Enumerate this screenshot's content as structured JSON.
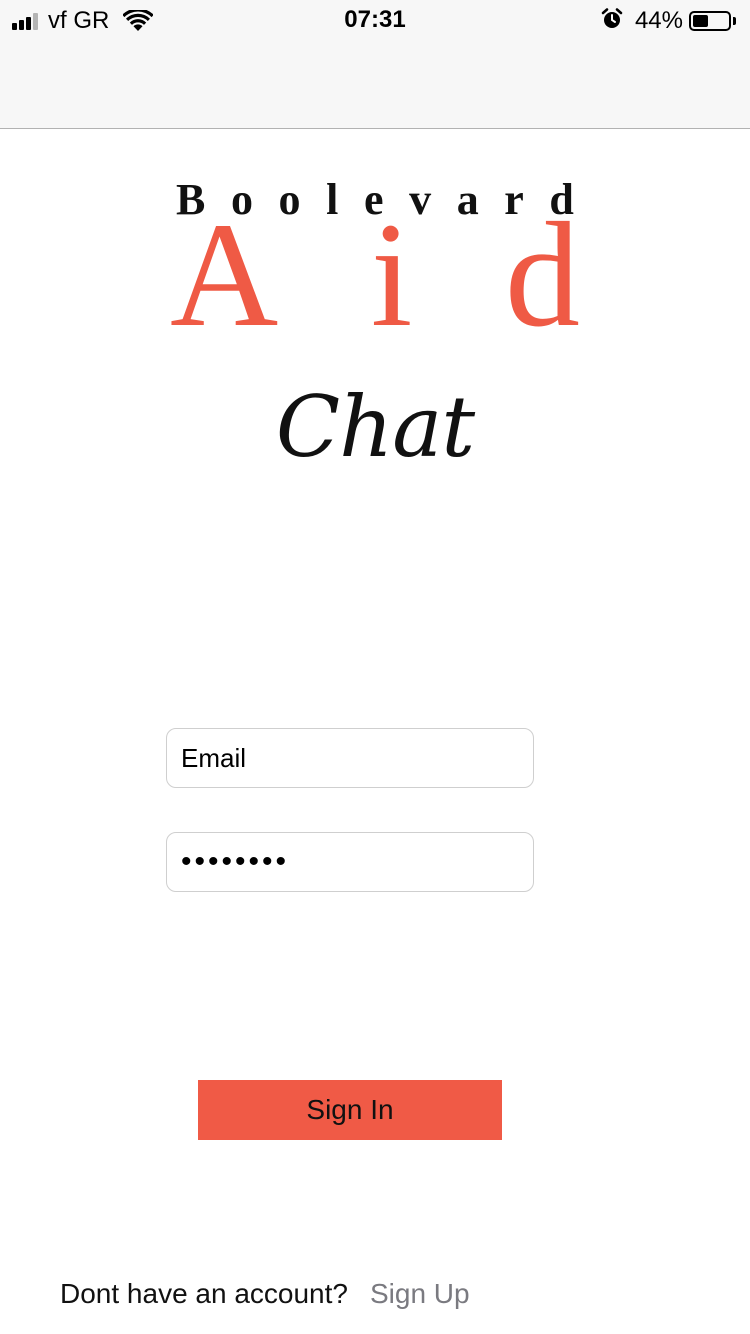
{
  "status_bar": {
    "carrier": "vf GR",
    "time": "07:31",
    "battery_percent": "44%",
    "battery_level": 0.44,
    "icons": [
      "signal-icon",
      "wifi-icon",
      "alarm-icon",
      "battery-icon"
    ]
  },
  "logo": {
    "top_letters": [
      "B",
      "o",
      "o",
      "l",
      "e",
      "v",
      "a",
      "r",
      "d"
    ],
    "aid_letters": [
      "A",
      "i",
      "d"
    ],
    "chat": "Chat",
    "accent_color": "#ef5a45"
  },
  "form": {
    "email_placeholder": "Email",
    "password_value": "••••••••"
  },
  "actions": {
    "signin_label": "Sign In",
    "signin_color": "#f05a46"
  },
  "footer": {
    "prompt": "Dont have an account?",
    "signup_label": "Sign Up"
  }
}
